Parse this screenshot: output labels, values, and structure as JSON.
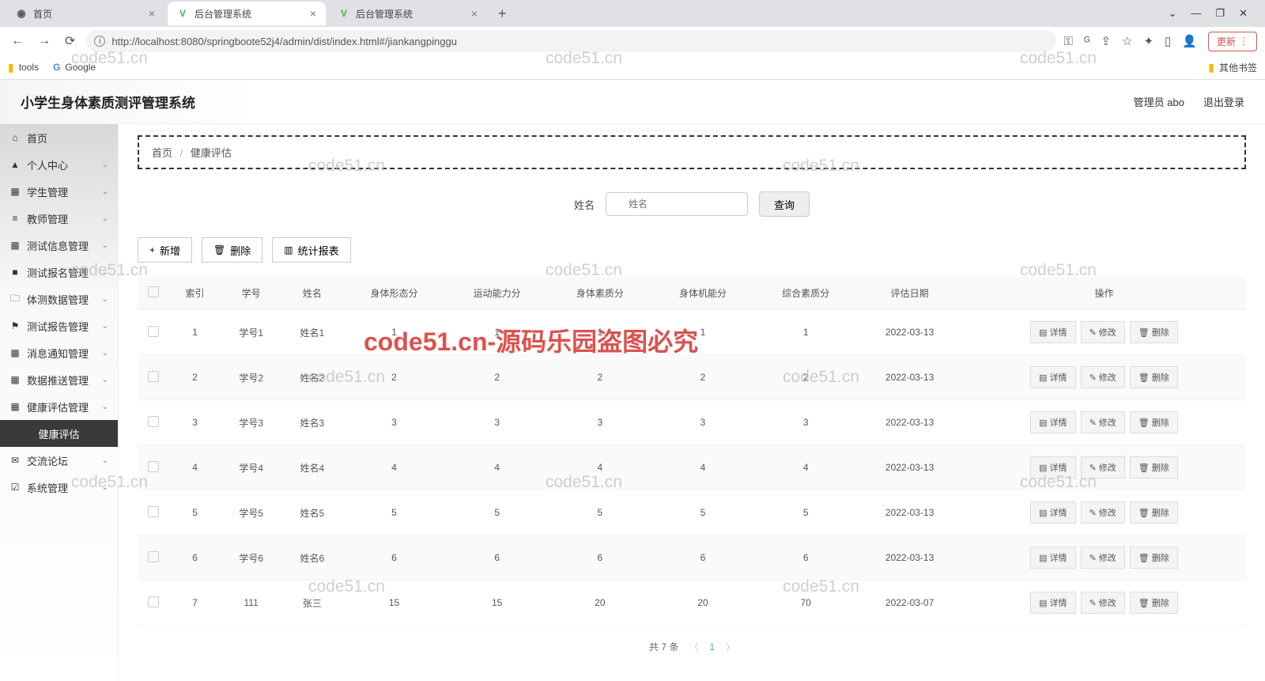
{
  "browser": {
    "tabs": [
      {
        "label": "首页",
        "favicon": "globe"
      },
      {
        "label": "后台管理系统",
        "favicon": "v"
      },
      {
        "label": "后台管理系统",
        "favicon": "v"
      }
    ],
    "url": "http://localhost:8080/springboote52j4/admin/dist/index.html#/jiankangpinggu",
    "update": "更新",
    "bookmarks": {
      "tools": "tools",
      "google": "Google",
      "other": "其他书签"
    }
  },
  "header": {
    "title": "小学生身体素质测评管理系统",
    "user": "管理员 abo",
    "logout": "退出登录"
  },
  "sidebar": {
    "items": [
      {
        "icon": "⌂",
        "label": "首页",
        "exp": false
      },
      {
        "icon": "▲",
        "label": "个人中心",
        "exp": true
      },
      {
        "icon": "▦",
        "label": "学生管理",
        "exp": true
      },
      {
        "icon": "≡",
        "label": "教师管理",
        "exp": true
      },
      {
        "icon": "▦",
        "label": "测试信息管理",
        "exp": true
      },
      {
        "icon": "■",
        "label": "测试报名管理",
        "exp": true
      },
      {
        "icon": "🗀",
        "label": "体测数据管理",
        "exp": true
      },
      {
        "icon": "⚑",
        "label": "测试报告管理",
        "exp": true
      },
      {
        "icon": "▦",
        "label": "消息通知管理",
        "exp": true
      },
      {
        "icon": "▦",
        "label": "数据推送管理",
        "exp": true
      },
      {
        "icon": "▦",
        "label": "健康评估管理",
        "exp": true
      }
    ],
    "active": "健康评估",
    "tail": [
      {
        "icon": "✉",
        "label": "交流论坛",
        "exp": true
      },
      {
        "icon": "☑",
        "label": "系统管理",
        "exp": true
      }
    ]
  },
  "breadcrumb": {
    "a": "首页",
    "b": "健康评估"
  },
  "search": {
    "label": "姓名",
    "placeholder": "姓名",
    "btn": "查询"
  },
  "toolbar": {
    "add": "新增",
    "del": "删除",
    "report": "统计报表"
  },
  "table": {
    "columns": [
      "索引",
      "学号",
      "姓名",
      "身体形态分",
      "运动能力分",
      "身体素质分",
      "身体机能分",
      "综合素质分",
      "评估日期",
      "操作"
    ],
    "actions": {
      "detail": "详情",
      "edit": "修改",
      "delete": "删除"
    },
    "rows": [
      {
        "idx": "1",
        "sid": "学号1",
        "name": "姓名1",
        "c1": "1",
        "c2": "1",
        "c3": "1",
        "c4": "1",
        "c5": "1",
        "date": "2022-03-13"
      },
      {
        "idx": "2",
        "sid": "学号2",
        "name": "姓名2",
        "c1": "2",
        "c2": "2",
        "c3": "2",
        "c4": "2",
        "c5": "2",
        "date": "2022-03-13"
      },
      {
        "idx": "3",
        "sid": "学号3",
        "name": "姓名3",
        "c1": "3",
        "c2": "3",
        "c3": "3",
        "c4": "3",
        "c5": "3",
        "date": "2022-03-13"
      },
      {
        "idx": "4",
        "sid": "学号4",
        "name": "姓名4",
        "c1": "4",
        "c2": "4",
        "c3": "4",
        "c4": "4",
        "c5": "4",
        "date": "2022-03-13"
      },
      {
        "idx": "5",
        "sid": "学号5",
        "name": "姓名5",
        "c1": "5",
        "c2": "5",
        "c3": "5",
        "c4": "5",
        "c5": "5",
        "date": "2022-03-13"
      },
      {
        "idx": "6",
        "sid": "学号6",
        "name": "姓名6",
        "c1": "6",
        "c2": "6",
        "c3": "6",
        "c4": "6",
        "c5": "6",
        "date": "2022-03-13"
      },
      {
        "idx": "7",
        "sid": "111",
        "name": "张三",
        "c1": "15",
        "c2": "15",
        "c3": "20",
        "c4": "20",
        "c5": "70",
        "date": "2022-03-07"
      }
    ]
  },
  "pagination": {
    "total": "共 7 条",
    "page": "1"
  },
  "watermark": {
    "text": "code51.cn",
    "red": "code51.cn-源码乐园盗图必究"
  }
}
